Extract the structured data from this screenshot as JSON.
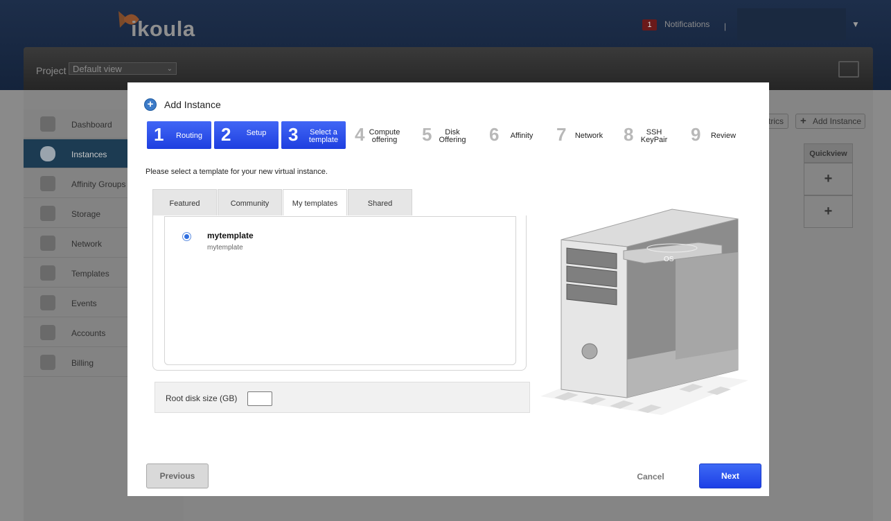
{
  "header": {
    "logo_text": "ikoula",
    "notifications": {
      "count": "1",
      "label": "Notifications",
      "separator": "|"
    },
    "user_menu_chevron": "▼"
  },
  "project": {
    "label": "Project",
    "selected": "Default view"
  },
  "sidebar": {
    "items": [
      {
        "label": "Dashboard",
        "icon": "dashboard-icon"
      },
      {
        "label": "Instances",
        "icon": "cloud-icon",
        "active": true
      },
      {
        "label": "Affinity Groups",
        "icon": "affinity-icon"
      },
      {
        "label": "Storage",
        "icon": "storage-icon"
      },
      {
        "label": "Network",
        "icon": "network-icon"
      },
      {
        "label": "Templates",
        "icon": "templates-icon"
      },
      {
        "label": "Events",
        "icon": "calendar-icon"
      },
      {
        "label": "Accounts",
        "icon": "user-icon"
      },
      {
        "label": "Billing",
        "icon": "billing-icon"
      }
    ]
  },
  "toolbar": {
    "metrics_label": "trics",
    "add_instance_label": "Add Instance"
  },
  "table": {
    "quickview_header": "Quickview",
    "row_action": "+"
  },
  "modal": {
    "title": "Add Instance",
    "steps": [
      {
        "num": "1",
        "label": "Routing",
        "state": "done"
      },
      {
        "num": "2",
        "label": "Setup",
        "state": "done"
      },
      {
        "num": "3",
        "label": "Select a template",
        "state": "done"
      },
      {
        "num": "4",
        "label": "Compute offering",
        "state": "todo"
      },
      {
        "num": "5",
        "label": "Disk Offering",
        "state": "todo"
      },
      {
        "num": "6",
        "label": "Affinity",
        "state": "todo"
      },
      {
        "num": "7",
        "label": "Network",
        "state": "todo"
      },
      {
        "num": "8",
        "label": "SSH KeyPair",
        "state": "todo"
      },
      {
        "num": "9",
        "label": "Review",
        "state": "todo"
      }
    ],
    "instruction": "Please select a template for your new virtual instance.",
    "tabs": [
      "Featured",
      "Community",
      "My templates",
      "Shared"
    ],
    "selected_tab": "My templates",
    "templates": [
      {
        "name": "mytemplate",
        "description": "mytemplate",
        "selected": true
      }
    ],
    "root_disk_label": "Root disk size (GB)",
    "root_disk_value": "",
    "illustration_label": "OS",
    "buttons": {
      "previous": "Previous",
      "cancel": "Cancel",
      "next": "Next"
    }
  },
  "colors": {
    "accent": "#2448ea",
    "topbar": "#1b2c47"
  }
}
